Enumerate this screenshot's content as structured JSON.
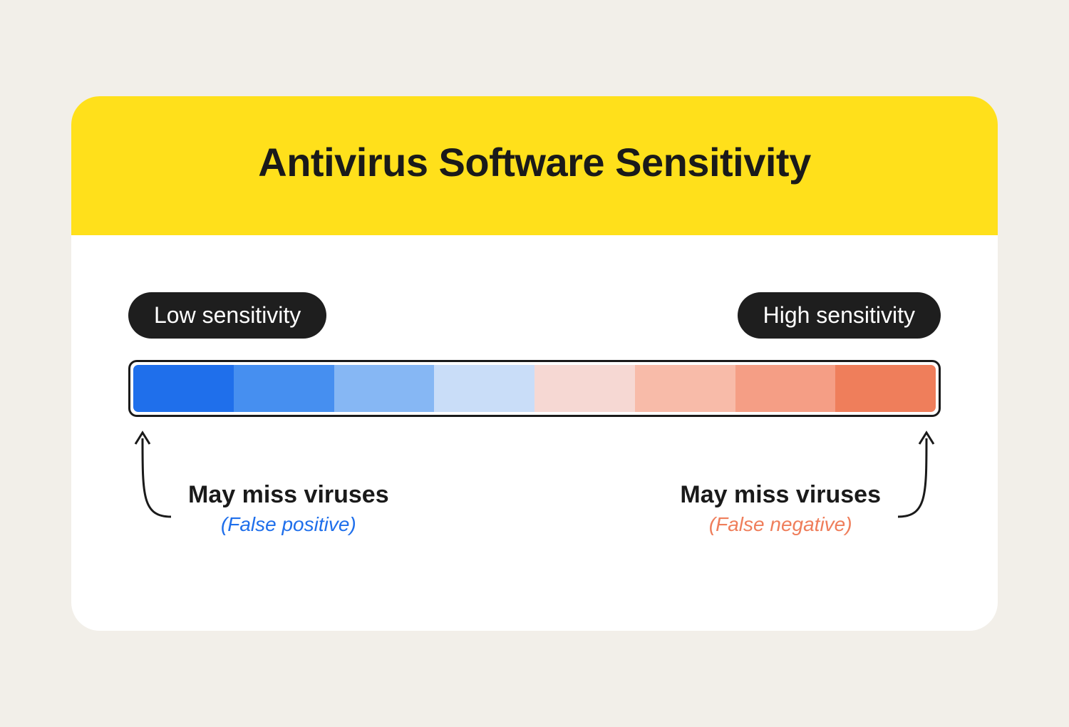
{
  "title": "Antivirus Software Sensitivity",
  "pills": {
    "low": "Low sensitivity",
    "high": "High sensitivity"
  },
  "spectrum_colors": [
    "#1f6feb",
    "#468ff0",
    "#86b7f4",
    "#c9ddf8",
    "#f6d8d3",
    "#f8bba9",
    "#f59e85",
    "#ef7e5b"
  ],
  "callouts": {
    "left": {
      "desc": "May miss viruses",
      "sub": "(False positive)",
      "sub_color": "#1f6feb"
    },
    "right": {
      "desc": "May miss viruses",
      "sub": "(False negative)",
      "sub_color": "#ef7e5b"
    }
  }
}
